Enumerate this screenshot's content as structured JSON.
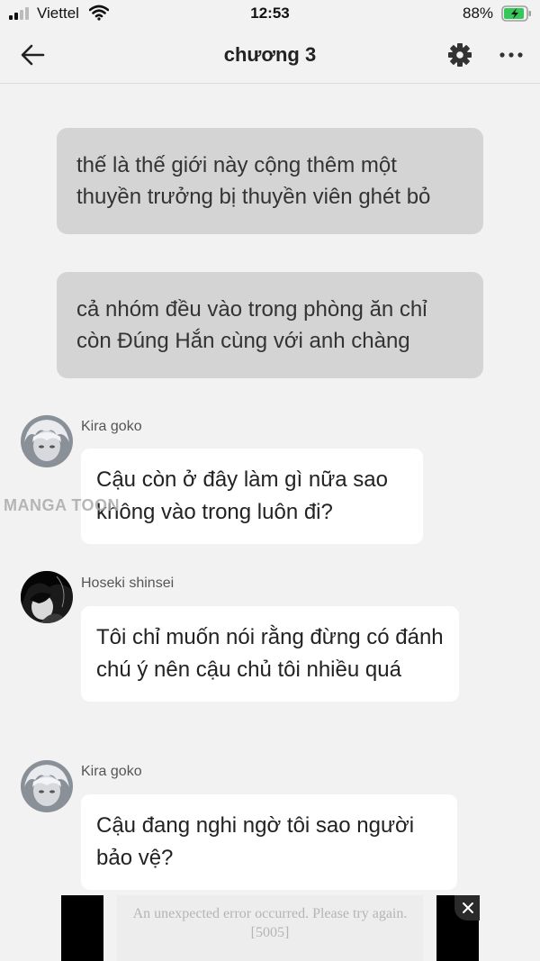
{
  "status_bar": {
    "carrier": "Viettel",
    "time": "12:53",
    "battery": "88%",
    "battery_color": "#35c759"
  },
  "header": {
    "title": "chương 3",
    "back_icon": "arrow-left-icon",
    "settings_icon": "gear-icon",
    "more_icon": "more-horizontal-icon"
  },
  "narration": [
    {
      "text": "thế là thế giới này cộng thêm một thuyền trưởng bị thuyền viên ghét bỏ"
    },
    {
      "text": "cả nhóm đều vào trong phòng ăn chỉ còn Đúng Hắn cùng với anh chàng"
    }
  ],
  "messages": [
    {
      "user": "Kira goko",
      "text": "Cậu còn ở đây làm gì nữa sao không vào trong luôn đi?"
    },
    {
      "user": "Hoseki shinsei",
      "text": "Tôi chỉ muốn nói rằng đừng có đánh chú ý nên cậu chủ tôi nhiều quá"
    },
    {
      "user": "Kira goko",
      "text": "Cậu đang nghi ngờ tôi sao người bảo vệ?"
    }
  ],
  "watermark": "MANGA TOON",
  "ad": {
    "message": "An unexpected error occurred. Please try again.[5005]",
    "close_icon": "close-icon"
  }
}
